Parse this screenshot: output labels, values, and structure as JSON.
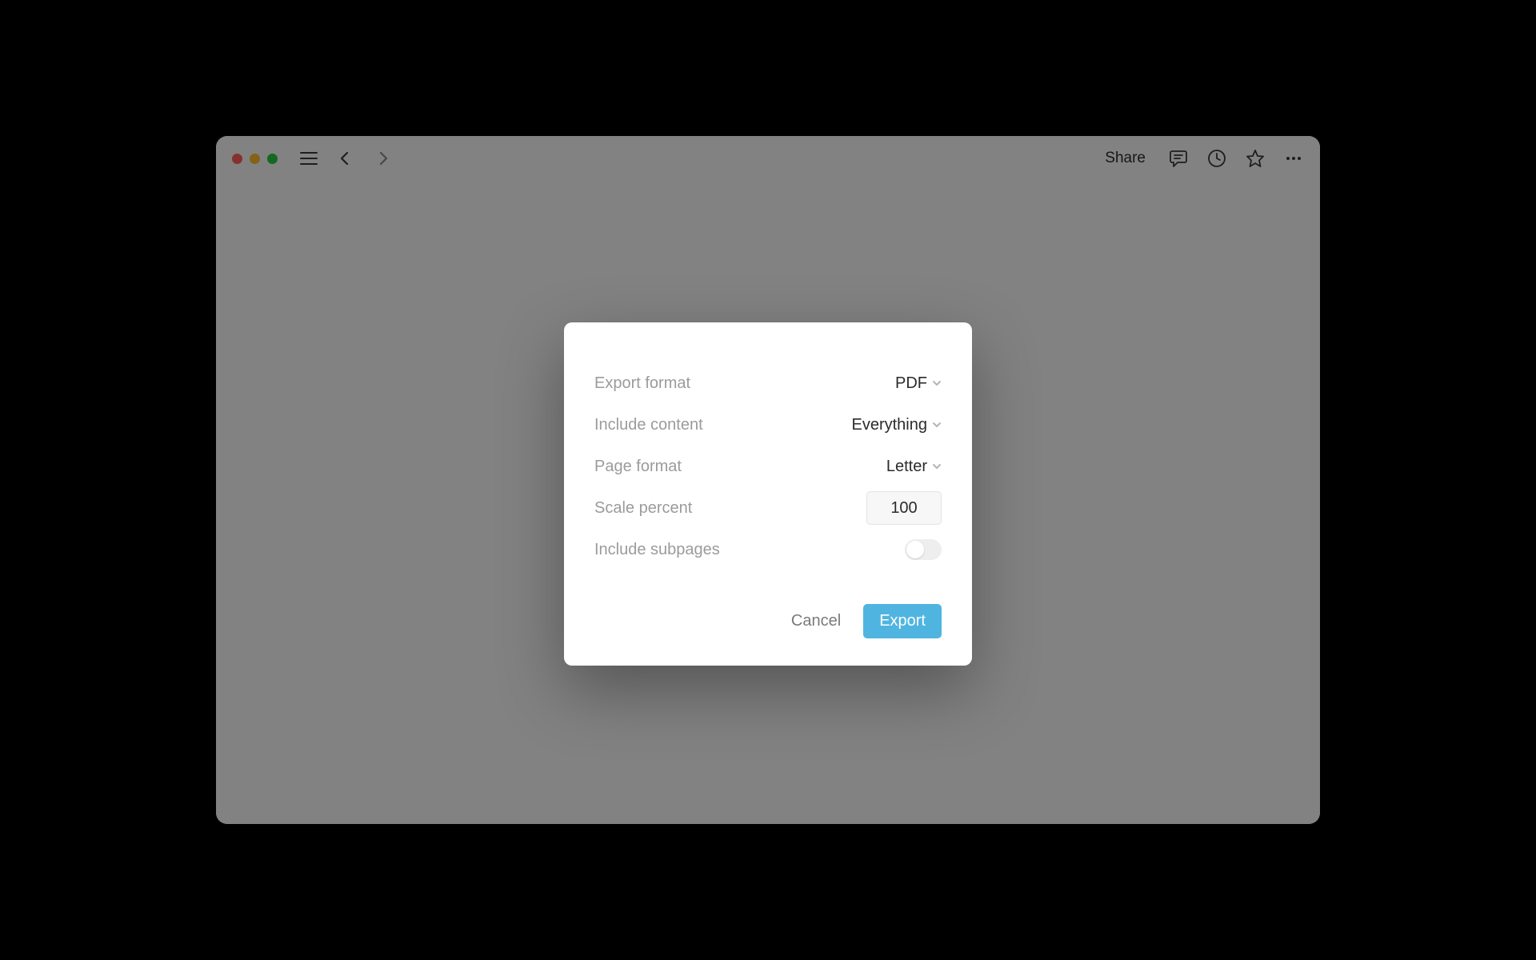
{
  "toolbar": {
    "share_label": "Share"
  },
  "modal": {
    "rows": {
      "export_format": {
        "label": "Export format",
        "value": "PDF"
      },
      "include_content": {
        "label": "Include content",
        "value": "Everything"
      },
      "page_format": {
        "label": "Page format",
        "value": "Letter"
      },
      "scale_percent": {
        "label": "Scale percent",
        "value": "100"
      },
      "include_subpages": {
        "label": "Include subpages",
        "enabled": false
      }
    },
    "buttons": {
      "cancel": "Cancel",
      "export": "Export"
    }
  },
  "colors": {
    "accent": "#4fb5e0"
  }
}
